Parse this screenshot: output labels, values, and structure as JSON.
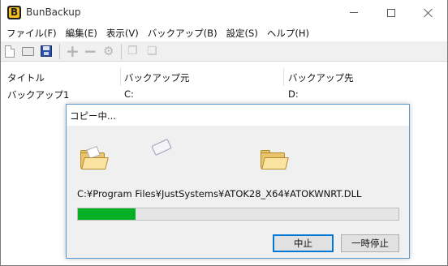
{
  "window": {
    "title": "BunBackup",
    "icon_letter": "B"
  },
  "menu": [
    "ファイル(F)",
    "編集(E)",
    "表示(V)",
    "バックアップ(B)",
    "設定(S)",
    "ヘルプ(H)"
  ],
  "toolbar": {
    "icons": [
      "new-file-icon",
      "open-folder-icon",
      "save-icon",
      "add-icon",
      "remove-icon",
      "properties-icon",
      "copy-icon",
      "copy-all-icon"
    ],
    "plus_glyph": "+",
    "minus_glyph": "−"
  },
  "list": {
    "columns": [
      "タイトル",
      "バックアップ元",
      "バックアップ先"
    ],
    "rows": [
      {
        "title": "バックアップ1",
        "source": "C:",
        "dest": "D:"
      }
    ]
  },
  "dialog": {
    "title": "コピー中...",
    "path": "C:¥Program Files¥JustSystems¥ATOK28_X64¥ATOKWNRT.DLL",
    "progress": 0.18,
    "stop_label": "中止",
    "pause_label": "一時停止",
    "progress_color": "#06b025"
  }
}
